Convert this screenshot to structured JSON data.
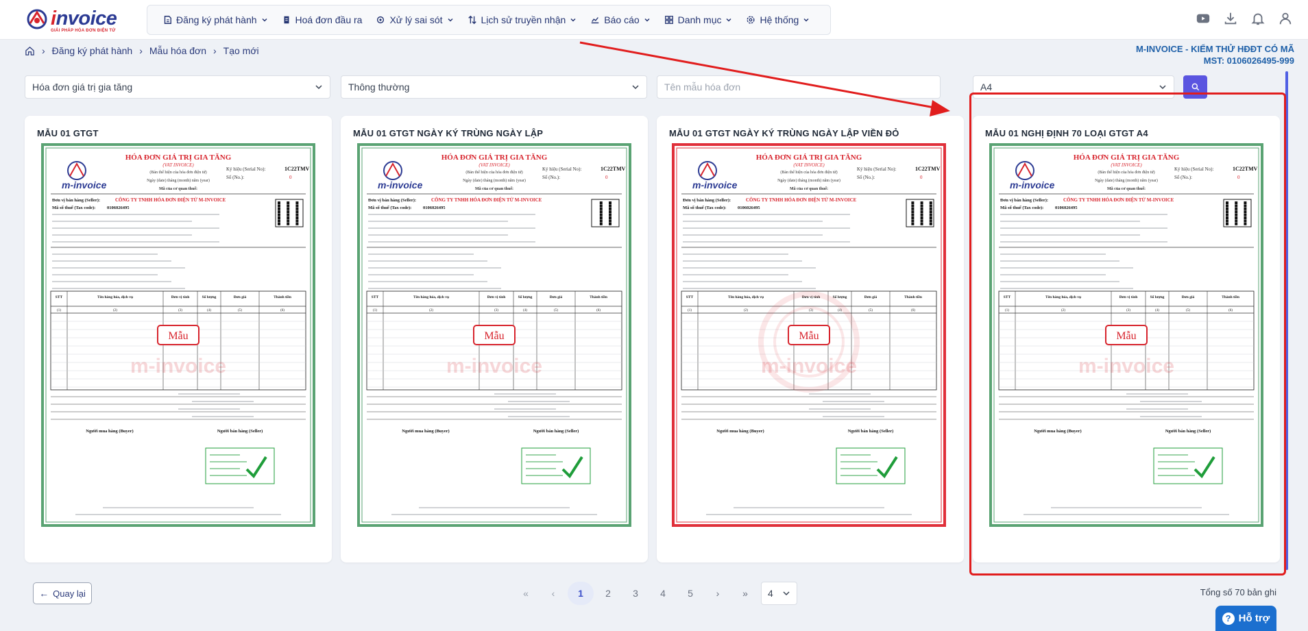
{
  "header": {
    "logo_text_i": "i",
    "logo_text_rest": "nvoice",
    "logo_sub": "GIẢI PHÁP HÓA ĐƠN ĐIỆN TỬ",
    "menu": [
      {
        "label": "Đăng ký phát hành",
        "icon": "file-register-icon",
        "dropdown": true
      },
      {
        "label": "Hoá đơn đầu ra",
        "icon": "invoice-out-icon",
        "dropdown": false
      },
      {
        "label": "Xử lý sai sót",
        "icon": "settings-fix-icon",
        "dropdown": true
      },
      {
        "label": "Lịch sử truyền nhận",
        "icon": "transfer-history-icon",
        "dropdown": true
      },
      {
        "label": "Báo cáo",
        "icon": "chart-report-icon",
        "dropdown": true
      },
      {
        "label": "Danh mục",
        "icon": "category-grid-icon",
        "dropdown": true
      },
      {
        "label": "Hệ thống",
        "icon": "gear-icon",
        "dropdown": true
      }
    ],
    "icons": [
      "youtube-icon",
      "download-icon",
      "bell-icon",
      "user-icon"
    ]
  },
  "breadcrumb": {
    "home_icon": "home-icon",
    "items": [
      "Đăng ký phát hành",
      "Mẫu hóa đơn",
      "Tạo mới"
    ]
  },
  "company": {
    "name": "M-INVOICE - KIỂM THỬ HĐĐT CÓ MÃ",
    "tax_code": "MST: 0106026495-999"
  },
  "filters": {
    "invoice_type": "Hóa đơn giá trị gia tăng",
    "template_style": "Thông thường",
    "template_name_placeholder": "Tên mẫu hóa đơn",
    "paper_size": "A4"
  },
  "cards": [
    {
      "title": "MẪU 01 GTGT",
      "invoice_heading": "HÓA ĐƠN GIÁ TRỊ GIA TĂNG",
      "serial": "1C22TMV",
      "stamp": "Mẫu",
      "seller": "CÔNG TY TNHH HÓA ĐƠN ĐIỆN TỬ M-INVOICE",
      "tax_id": "0106026495"
    },
    {
      "title": "MẪU 01 GTGT NGÀY KÝ TRÙNG NGÀY LẬP",
      "invoice_heading": "HÓA ĐƠN GIÁ TRỊ GIA TĂNG",
      "serial": "1C22TMV",
      "stamp": "Mẫu",
      "seller": "CÔNG TY TNHH HÓA ĐƠN ĐIỆN TỬ M-INVOICE",
      "tax_id": "0106026495"
    },
    {
      "title": "MẪU 01 GTGT NGÀY KÝ TRÙNG NGÀY LẬP VIỀN ĐỎ",
      "invoice_heading": "HÓA ĐƠN GIÁ TRỊ GIA TĂNG",
      "serial": "1C22TMV",
      "stamp": "Mẫu",
      "seller": "CÔNG TY TNHH HÓA ĐƠN ĐIỆN TỬ M-INVOICE",
      "tax_id": "0106026495"
    },
    {
      "title": "MẪU 01 NGHỊ ĐỊNH 70 LOẠI GTGT A4",
      "invoice_heading": "HÓA ĐƠN GIÁ TRỊ GIA TĂNG",
      "serial": "1C22TMV",
      "stamp": "Mẫu",
      "seller": "CÔNG TY TNHH HÓA ĐƠN ĐIỆN TỬ M-INVOICE",
      "tax_id": "0106026495"
    }
  ],
  "pagination": {
    "back_label": "Quay lại",
    "pages": [
      "1",
      "2",
      "3",
      "4",
      "5"
    ],
    "current_page": "1",
    "page_size": "4",
    "total": "Tổng số 70 bản ghi"
  },
  "help": {
    "label": "Hỗ trợ"
  },
  "colors": {
    "accent": "#5a55e0",
    "brand_blue": "#2b3a93",
    "brand_red": "#d7232c",
    "highlight": "#e11d1d"
  }
}
